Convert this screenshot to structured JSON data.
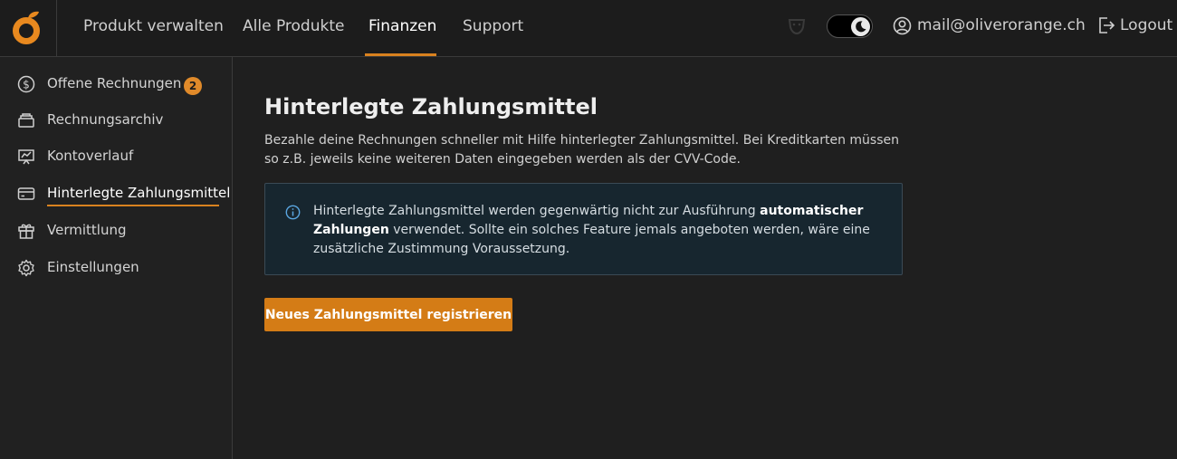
{
  "topnav": {
    "items": [
      {
        "label": "Produkt verwalten"
      },
      {
        "label": "Alle Produkte"
      },
      {
        "label": "Finanzen"
      },
      {
        "label": "Support"
      }
    ],
    "active": "Finanzen",
    "user_email": "mail@oliverorange.ch",
    "logout_label": "Logout",
    "theme_toggle": "dark"
  },
  "sidebar": {
    "items": [
      {
        "label": "Offene Rechnungen",
        "icon": "dollar-circle-icon",
        "badge": "2"
      },
      {
        "label": "Rechnungsarchiv",
        "icon": "archive-icon"
      },
      {
        "label": "Kontoverlauf",
        "icon": "chart-board-icon"
      },
      {
        "label": "Hinterlegte Zahlungsmittel",
        "icon": "credit-card-icon"
      },
      {
        "label": "Vermittlung",
        "icon": "gift-icon"
      },
      {
        "label": "Einstellungen",
        "icon": "gear-icon"
      }
    ],
    "active": "Hinterlegte Zahlungsmittel"
  },
  "main": {
    "title": "Hinterlegte Zahlungsmittel",
    "description": "Bezahle deine Rechnungen schneller mit Hilfe hinterlegter Zahlungsmittel. Bei Kreditkarten müssen so z.B. jeweils keine weiteren Daten eingegeben werden als der CVV-Code.",
    "info": {
      "text_before": "Hinterlegte Zahlungsmittel werden gegenwärtig nicht zur Ausführung ",
      "text_bold": "automatischer Zahlungen",
      "text_after": " verwendet. Sollte ein solches Feature jemals angeboten werden, wäre eine zusätzliche Zustimmung Voraussetzung."
    },
    "register_button": "Neues Zahlungsmittel registrieren"
  },
  "colors": {
    "accent": "#d47c16",
    "background": "#1f1f1f",
    "info_bg": "#17262f"
  }
}
